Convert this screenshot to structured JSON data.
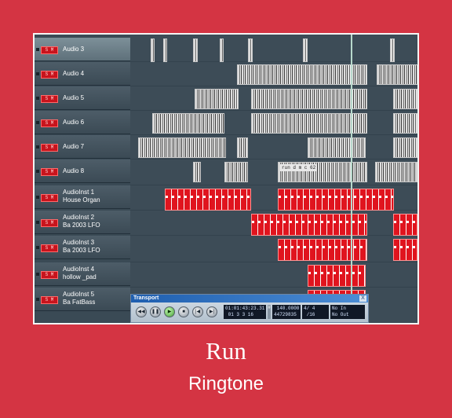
{
  "tracks": [
    {
      "name": "Audio 3",
      "mute_label": "S M"
    },
    {
      "name": "Audio 4",
      "mute_label": "S M"
    },
    {
      "name": "Audio 5",
      "mute_label": "S M"
    },
    {
      "name": "Audio 6",
      "mute_label": "S M"
    },
    {
      "name": "Audio 7",
      "mute_label": "S M"
    },
    {
      "name": "Audio 8",
      "mute_label": "S M"
    },
    {
      "name": "AudioInst 1\nHouse Organ",
      "mute_label": "S M"
    },
    {
      "name": "AudioInst 2\nBa 2003 LFO",
      "mute_label": "S M"
    },
    {
      "name": "AudioInst 3\nBa 2003 LFO",
      "mute_label": "S M"
    },
    {
      "name": "AudioInst 4\nhollow _pad",
      "mute_label": "S M"
    },
    {
      "name": "AudioInst 5\nBa FatBass",
      "mute_label": "S M"
    }
  ],
  "clip_label": "run d m c 62",
  "transport": {
    "title": "Transport",
    "close": "X",
    "time": "01:01:43:23.31\n 01 3 3 16",
    "tempo_sep": "#",
    "tempo": " 140.0000\n44729835",
    "signature": "4/ 4\n /16",
    "inout": "No In\nNo Out",
    "buttons": [
      "◀◀",
      "❚❚",
      "▶",
      "■",
      "|◀",
      "▶|"
    ]
  },
  "caption": {
    "title": "Run",
    "subtitle": "Ringtone"
  },
  "colors": {
    "background": "#d43443",
    "clip_red": "#e0141e",
    "clip_gray": "#dcdcdc"
  }
}
